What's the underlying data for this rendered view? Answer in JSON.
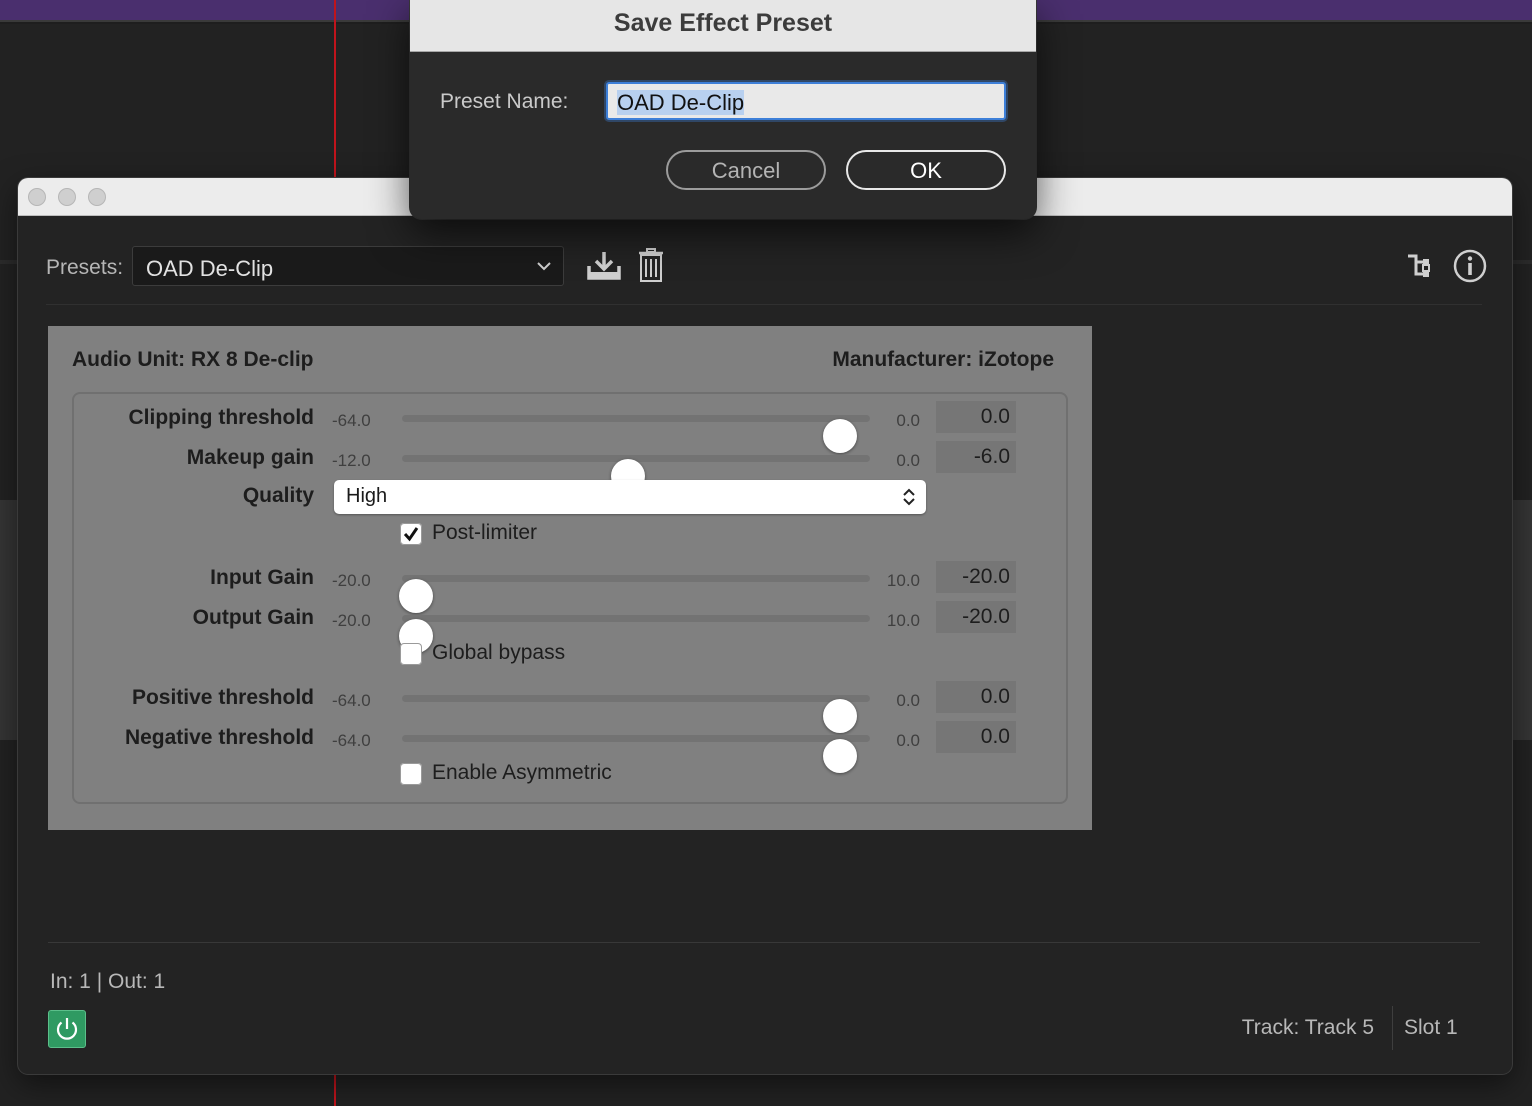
{
  "dialog": {
    "title": "Save Effect Preset",
    "preset_name_label": "Preset Name:",
    "preset_name_value": "OAD De-Clip",
    "cancel_label": "Cancel",
    "ok_label": "OK"
  },
  "toolbar": {
    "presets_label": "Presets:",
    "presets_value": "OAD De-Clip",
    "icons": [
      "save-preset-icon",
      "delete-preset-icon",
      "routing-icon",
      "info-icon"
    ]
  },
  "au": {
    "title": "Audio Unit: RX 8 De-clip",
    "manufacturer": "Manufacturer: iZotope"
  },
  "params": {
    "clipping_threshold": {
      "label": "Clipping threshold",
      "min": "-64.0",
      "max": "0.0",
      "value": "0.0",
      "fraction": 1.0
    },
    "makeup_gain": {
      "label": "Makeup gain",
      "min": "-12.0",
      "max": "0.0",
      "value": "-6.0",
      "fraction": 0.5
    },
    "quality": {
      "label": "Quality",
      "value": "High"
    },
    "post_limiter": {
      "label": "Post-limiter",
      "checked": true
    },
    "input_gain": {
      "label": "Input Gain",
      "min": "-20.0",
      "max": "10.0",
      "value": "-20.0",
      "fraction": 0.0
    },
    "output_gain": {
      "label": "Output Gain",
      "min": "-20.0",
      "max": "10.0",
      "value": "-20.0",
      "fraction": 0.0
    },
    "global_bypass": {
      "label": "Global bypass",
      "checked": false
    },
    "positive_threshold": {
      "label": "Positive threshold",
      "min": "-64.0",
      "max": "0.0",
      "value": "0.0",
      "fraction": 1.0
    },
    "negative_threshold": {
      "label": "Negative threshold",
      "min": "-64.0",
      "max": "0.0",
      "value": "0.0",
      "fraction": 1.0
    },
    "enable_asymmetric": {
      "label": "Enable Asymmetric",
      "checked": false
    }
  },
  "footer": {
    "io": "In: 1 | Out: 1",
    "track": "Track: Track 5",
    "slot": "Slot 1",
    "power_on": true
  },
  "colors": {
    "playhead": "#c0141c",
    "power_green": "#2f9a62",
    "focus_blue": "#3d7fd8"
  }
}
